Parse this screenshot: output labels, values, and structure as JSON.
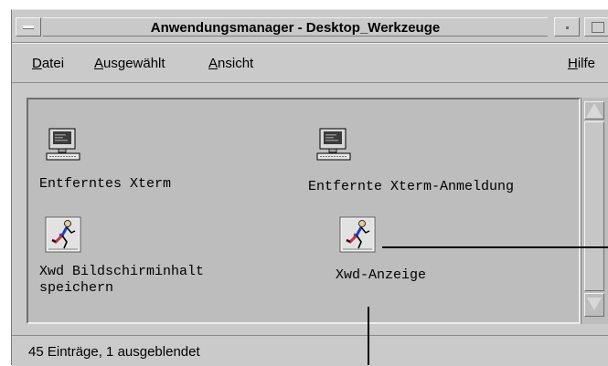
{
  "window": {
    "title": "Anwendungsmanager - Desktop_Werkzeuge"
  },
  "menubar": {
    "items": [
      {
        "mnemonic": "D",
        "rest": "atei"
      },
      {
        "mnemonic": "A",
        "rest": "usgewählt"
      },
      {
        "mnemonic": "A",
        "rest": "nsicht"
      },
      {
        "mnemonic": "H",
        "rest": "ilfe"
      }
    ]
  },
  "content": {
    "icons": [
      {
        "label": "Entferntes Xterm",
        "icon": "computer-terminal-icon"
      },
      {
        "label": "Entfernte Xterm-Anmeldung",
        "icon": "computer-terminal-icon"
      },
      {
        "label": "Xwd Bildschirminhalt\nspeichern",
        "icon": "runner-icon"
      },
      {
        "label": "Xwd-Anzeige",
        "icon": "runner-icon"
      }
    ]
  },
  "statusbar": {
    "text": "45 Einträge, 1 ausgeblendet"
  },
  "colors": {
    "window_bg": "#cacaca",
    "content_bg": "#bdbdbd",
    "runner_shirt": "#1f3fbf",
    "runner_shorts": "#c0304a"
  }
}
